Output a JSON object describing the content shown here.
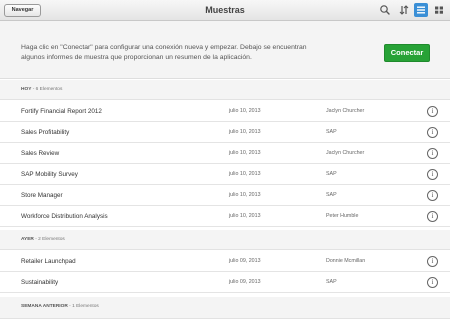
{
  "header": {
    "nav_button": "Navegar",
    "title": "Muestras",
    "icons": [
      "search-icon",
      "sort-icon",
      "list-view-icon",
      "grid-view-icon"
    ],
    "active_view": "list"
  },
  "intro": {
    "line1": "Haga clic en \"Conectar\" para configurar una conexión nueva y empezar. Debajo se encuentran",
    "line2": "algunos informes de muestra que proporcionan un resumen de la aplicación.",
    "connect_label": "Conectar",
    "connect_color": "#27a236"
  },
  "sections": [
    {
      "name": "HOY",
      "count": "- 6 Elementos",
      "rows": [
        {
          "name": "Fortify Financial Report 2012",
          "date": "julio 10, 2013",
          "owner": "Jaclyn  Churcher"
        },
        {
          "name": "Sales Profitability",
          "date": "julio 10, 2013",
          "owner": "SAP"
        },
        {
          "name": "Sales Review",
          "date": "julio 10, 2013",
          "owner": "Jaclyn  Churcher"
        },
        {
          "name": "SAP Mobility Survey",
          "date": "julio 10, 2013",
          "owner": "SAP"
        },
        {
          "name": "Store Manager",
          "date": "julio 10, 2013",
          "owner": "SAP"
        },
        {
          "name": "Workforce Distribution Analysis",
          "date": "julio 10, 2013",
          "owner": "Peter Humble"
        }
      ]
    },
    {
      "name": "AYER",
      "count": "- 2 Elementos",
      "rows": [
        {
          "name": "Retailer Launchpad",
          "date": "julio 09, 2013",
          "owner": "Donnie Mcmillan"
        },
        {
          "name": "Sustainability",
          "date": "julio 09, 2013",
          "owner": "SAP"
        }
      ]
    },
    {
      "name": "SEMANA ANTERIOR",
      "count": "- 1 Elementos",
      "rows": []
    }
  ],
  "info_glyph": "i"
}
